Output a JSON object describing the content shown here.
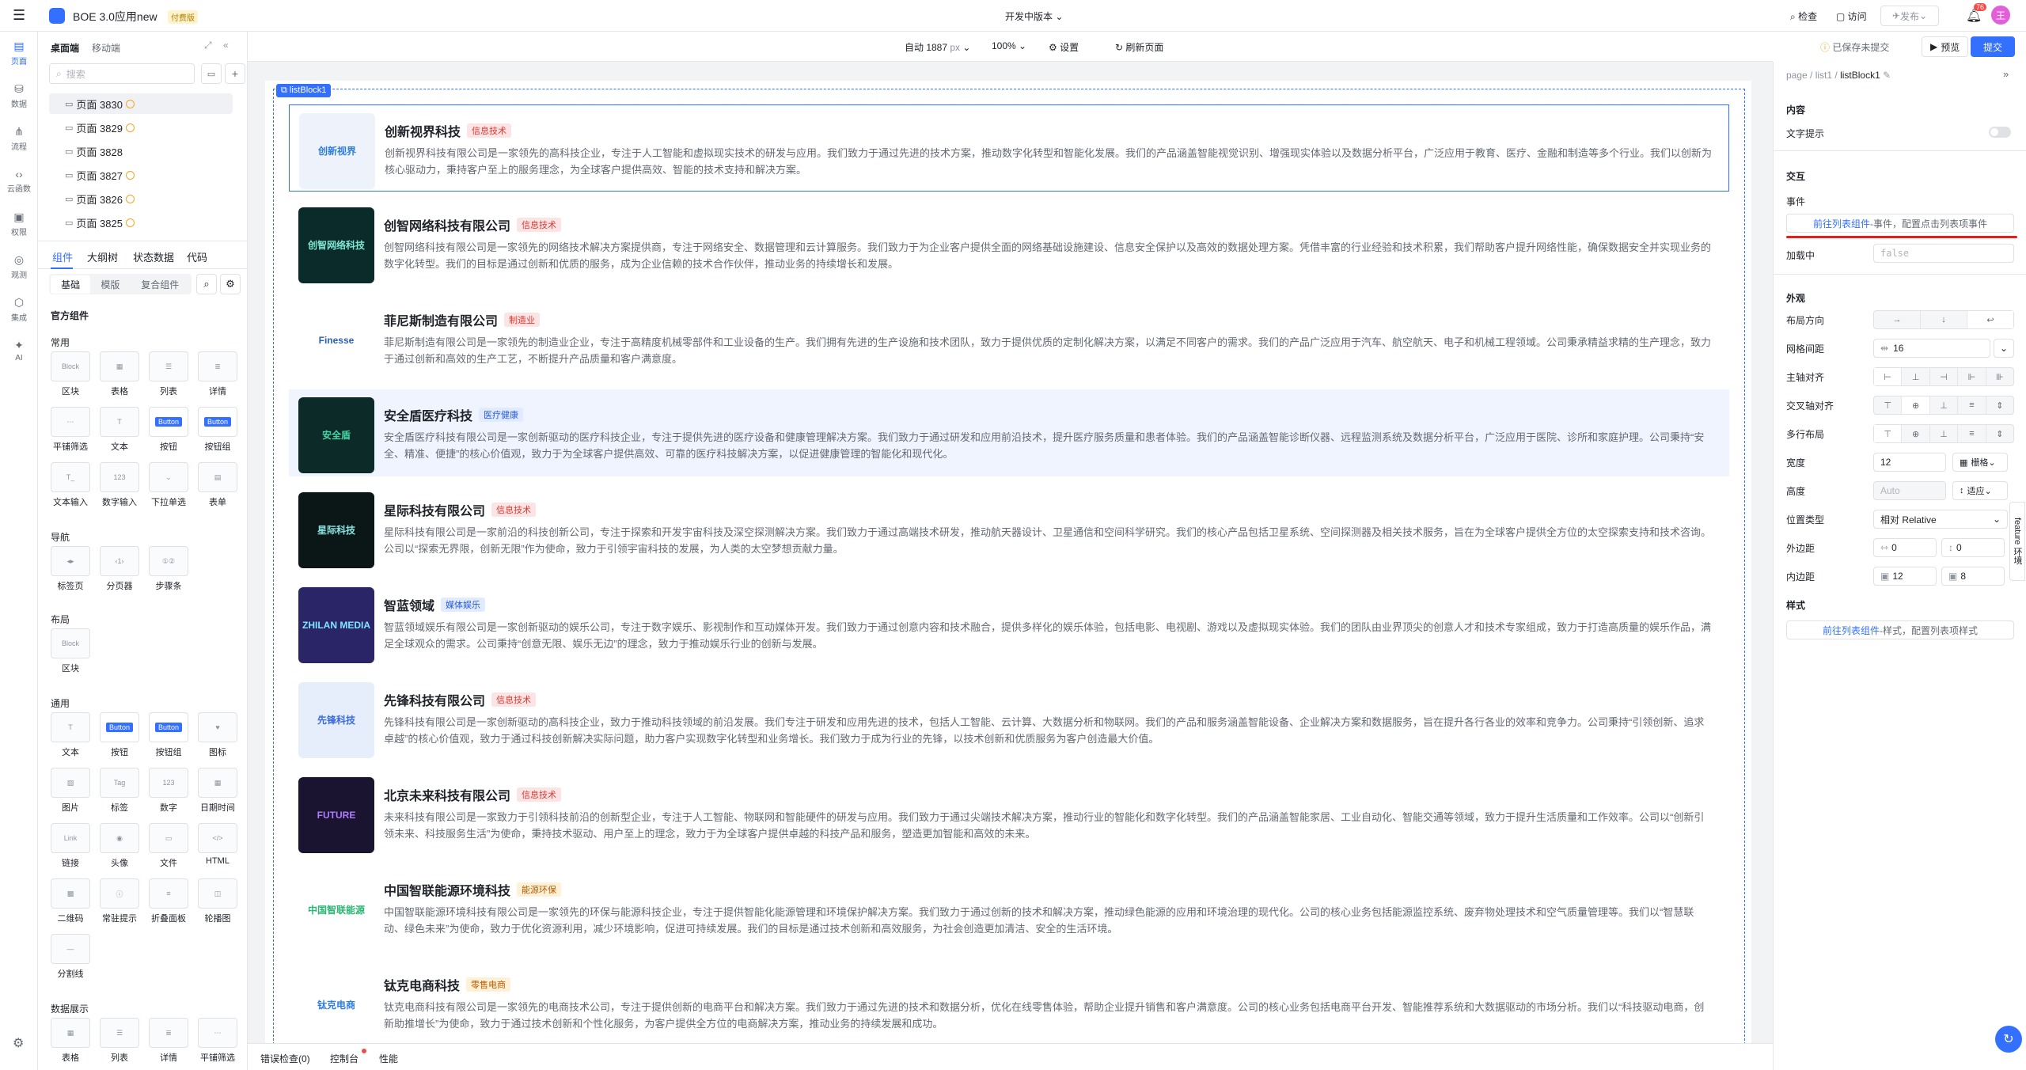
{
  "app": {
    "title": "BOE 3.0应用new",
    "badge": "付费版",
    "version_label": "开发中版本",
    "notify_count": "76",
    "avatar": "王",
    "top_actions": [
      "检查",
      "访问",
      "发布"
    ],
    "save_status": "已保存未提交",
    "preview": "预览",
    "submit": "提交"
  },
  "rail": [
    {
      "icon": "page-icon",
      "label": "页面"
    },
    {
      "icon": "data-icon",
      "label": "数据"
    },
    {
      "icon": "flow-icon",
      "label": "流程"
    },
    {
      "icon": "cloud-function-icon",
      "label": "云函数"
    },
    {
      "icon": "permission-icon",
      "label": "权限"
    },
    {
      "icon": "observe-icon",
      "label": "观测"
    },
    {
      "icon": "integrate-icon",
      "label": "集成"
    },
    {
      "icon": "ai-icon",
      "label": "AI"
    }
  ],
  "left": {
    "tabs": [
      "桌面端",
      "移动端"
    ],
    "search_placeholder": "搜索",
    "pages": [
      "页面 3830",
      "页面 3829",
      "页面 3828",
      "页面 3827",
      "页面 3826",
      "页面 3825"
    ],
    "sub_tabs": [
      "组件",
      "大纲树",
      "状态数据",
      "代码"
    ],
    "chips": [
      "基础",
      "模版",
      "复合组件"
    ],
    "official": "官方组件",
    "groups": [
      {
        "title": "常用",
        "items": [
          "区块",
          "表格",
          "列表",
          "详情",
          "平铺筛选",
          "文本",
          "按钮",
          "按钮组",
          "文本输入",
          "数字输入",
          "下拉单选",
          "表单"
        ]
      },
      {
        "title": "导航",
        "items": [
          "标签页",
          "分页器",
          "步骤条"
        ]
      },
      {
        "title": "布局",
        "items": [
          "区块"
        ]
      },
      {
        "title": "通用",
        "items": [
          "文本",
          "按钮",
          "按钮组",
          "图标",
          "图片",
          "标签",
          "数字",
          "日期时间",
          "链接",
          "头像",
          "文件",
          "HTML",
          "二维码",
          "常驻提示",
          "折叠面板",
          "轮播图",
          "分割线"
        ]
      },
      {
        "title": "数据展示",
        "items": [
          "表格",
          "列表",
          "详情",
          "平铺筛选"
        ]
      }
    ]
  },
  "toolbar": {
    "width": "自动 1887",
    "unit": "px",
    "zoom": "100%",
    "settings": "设置",
    "refresh": "刷新页面"
  },
  "canvas": {
    "selected_label": "listBlock1",
    "cards": [
      {
        "name": "创新视界科技",
        "tag": "信息技术",
        "logo": "创新视界",
        "desc": "创新视界科技有限公司是一家领先的高科技企业，专注于人工智能和虚拟现实技术的研发与应用。我们致力于通过先进的技术方案，推动数字化转型和智能化发展。我们的产品涵盖智能视觉识别、增强现实体验以及数据分析平台，广泛应用于教育、医疗、金融和制造等多个行业。我们以创新为核心驱动力，秉持客户至上的服务理念，为全球客户提供高效、智能的技术支持和解决方案。"
      },
      {
        "name": "创智网络科技有限公司",
        "tag": "信息技术",
        "logo": "创智网络科技",
        "desc": "创智网络科技有限公司是一家领先的网络技术解决方案提供商，专注于网络安全、数据管理和云计算服务。我们致力于为企业客户提供全面的网络基础设施建设、信息安全保护以及高效的数据处理方案。凭借丰富的行业经验和技术积累，我们帮助客户提升网络性能，确保数据安全并实现业务的数字化转型。我们的目标是通过创新和优质的服务，成为企业信赖的技术合作伙伴，推动业务的持续增长和发展。"
      },
      {
        "name": "菲尼斯制造有限公司",
        "tag": "制造业",
        "logo": "Finesse",
        "desc": "菲尼斯制造有限公司是一家领先的制造业企业，专注于高精度机械零部件和工业设备的生产。我们拥有先进的生产设施和技术团队，致力于提供优质的定制化解决方案，以满足不同客户的需求。我们的产品广泛应用于汽车、航空航天、电子和机械工程领域。公司秉承精益求精的生产理念，致力于通过创新和高效的生产工艺，不断提升产品质量和客户满意度。"
      },
      {
        "name": "安全盾医疗科技",
        "tag": "医疗健康",
        "logo": "安全盾",
        "desc": "安全盾医疗科技有限公司是一家创新驱动的医疗科技企业，专注于提供先进的医疗设备和健康管理解决方案。我们致力于通过研发和应用前沿技术，提升医疗服务质量和患者体验。我们的产品涵盖智能诊断仪器、远程监测系统及数据分析平台，广泛应用于医院、诊所和家庭护理。公司秉持“安全、精准、便捷”的核心价值观，致力于为全球客户提供高效、可靠的医疗科技解决方案，以促进健康管理的智能化和现代化。"
      },
      {
        "name": "星际科技有限公司",
        "tag": "信息技术",
        "logo": "星际科技",
        "desc": "星际科技有限公司是一家前沿的科技创新公司，专注于探索和开发宇宙科技及深空探测解决方案。我们致力于通过高端技术研发，推动航天器设计、卫星通信和空间科学研究。我们的核心产品包括卫星系统、空间探测器及相关技术服务，旨在为全球客户提供全方位的太空探索支持和技术咨询。公司以“探索无界限，创新无限”作为使命，致力于引领宇宙科技的发展，为人类的太空梦想贡献力量。"
      },
      {
        "name": "智蓝领域",
        "tag": "媒体娱乐",
        "logo": "ZHILAN MEDIA",
        "desc": "智蓝领域娱乐有限公司是一家创新驱动的娱乐公司，专注于数字娱乐、影视制作和互动媒体开发。我们致力于通过创意内容和技术融合，提供多样化的娱乐体验，包括电影、电视剧、游戏以及虚拟现实体验。我们的团队由业界顶尖的创意人才和技术专家组成，致力于打造高质量的娱乐作品，满足全球观众的需求。公司秉持“创意无限、娱乐无边”的理念，致力于推动娱乐行业的创新与发展。"
      },
      {
        "name": "先锋科技有限公司",
        "tag": "信息技术",
        "logo": "先锋科技",
        "desc": "先锋科技有限公司是一家创新驱动的高科技企业，致力于推动科技领域的前沿发展。我们专注于研发和应用先进的技术，包括人工智能、云计算、大数据分析和物联网。我们的产品和服务涵盖智能设备、企业解决方案和数据服务，旨在提升各行各业的效率和竞争力。公司秉持“引领创新、追求卓越”的核心价值观，致力于通过科技创新解决实际问题，助力客户实现数字化转型和业务增长。我们致力于成为行业的先锋，以技术创新和优质服务为客户创造最大价值。"
      },
      {
        "name": "北京未来科技有限公司",
        "tag": "信息技术",
        "logo": "FUTURE",
        "desc": "未来科技有限公司是一家致力于引领科技前沿的创新型企业，专注于人工智能、物联网和智能硬件的研发与应用。我们致力于通过尖端技术解决方案，推动行业的智能化和数字化转型。我们的产品涵盖智能家居、工业自动化、智能交通等领域，致力于提升生活质量和工作效率。公司以“创新引领未来、科技服务生活”为使命，秉持技术驱动、用户至上的理念，致力于为全球客户提供卓越的科技产品和服务，塑造更加智能和高效的未来。"
      },
      {
        "name": "中国智联能源环境科技",
        "tag": "能源环保",
        "logo": "中国智联能源",
        "desc": "中国智联能源环境科技有限公司是一家领先的环保与能源科技企业，专注于提供智能化能源管理和环境保护解决方案。我们致力于通过创新的技术和解决方案，推动绿色能源的应用和环境治理的现代化。公司的核心业务包括能源监控系统、废弃物处理技术和空气质量管理等。我们以“智慧联动、绿色未来”为使命，致力于优化资源利用，减少环境影响，促进可持续发展。我们的目标是通过技术创新和高效服务，为社会创造更加清洁、安全的生活环境。"
      },
      {
        "name": "钛克电商科技",
        "tag": "零售电商",
        "logo": "钛克电商",
        "desc": "钛克电商科技有限公司是一家领先的电商技术公司，专注于提供创新的电商平台和解决方案。我们致力于通过先进的技术和数据分析，优化在线零售体验，帮助企业提升销售和客户满意度。公司的核心业务包括电商平台开发、智能推荐系统和大数据驱动的市场分析。我们以“科技驱动电商，创新助推增长”为使命，致力于通过技术创新和个性化服务，为客户提供全方位的电商解决方案，推动业务的持续发展和成功。"
      }
    ]
  },
  "bottom": [
    "错误检查(0)",
    "控制台",
    "性能"
  ],
  "right": {
    "breadcrumb": [
      "page",
      "list1",
      "listBlock1"
    ],
    "sections": {
      "content": "内容",
      "interact": "交互",
      "appearance": "外观",
      "style": "样式"
    },
    "text_hint": "文字提示",
    "event_label": "事件",
    "event_link": "前往列表组件",
    "event_text": "-事件，配置点击列表项事件",
    "loading_label": "加载中",
    "loading_value": "false",
    "rows": [
      "布局方向",
      "网格间距",
      "主轴对齐",
      "交叉轴对齐",
      "多行布局",
      "宽度",
      "高度",
      "位置类型",
      "外边距",
      "内边距"
    ],
    "grid_gap": "16",
    "width": "12",
    "width_unit": "栅格",
    "height_placeholder": "Auto",
    "height_unit": "适应",
    "position": "相对 Relative",
    "margin": [
      "0",
      "0"
    ],
    "padding": [
      "12",
      "8"
    ],
    "style_link": "前往列表组件",
    "style_text": "-样式，配置列表项样式",
    "side_tab": "feature 环境"
  }
}
